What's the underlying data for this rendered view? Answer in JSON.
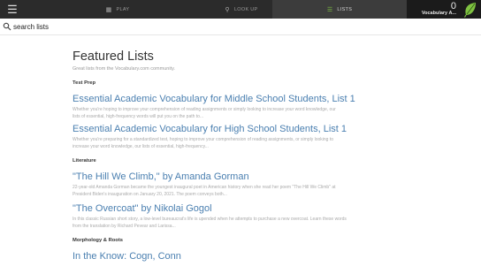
{
  "topbar": {
    "menu_icon": "hamburger-menu-icon",
    "nav": [
      {
        "label": "PLAY",
        "icon": "grid-icon"
      },
      {
        "label": "LOOK UP",
        "icon": "magnifier-icon"
      },
      {
        "label": "LISTS",
        "icon": "list-icon",
        "active": true
      }
    ],
    "user": {
      "score": "0",
      "name": "Vocabulary A..."
    },
    "accent_color": "#7fc241"
  },
  "search": {
    "placeholder": "search lists",
    "value": ""
  },
  "main": {
    "title": "Featured Lists",
    "subtitle": "Great lists from the Vocabulary.com community.",
    "sections": [
      {
        "title": "Test Prep",
        "lists": [
          {
            "title": "Essential Academic Vocabulary for Middle School Students, List 1",
            "desc1": "Whether you're hoping to improve your comprehension of reading assignments or simply looking to increase your word knowledge, our",
            "desc2": "lists of essential, high-frequency words will put you on the path to..."
          },
          {
            "title": "Essential Academic Vocabulary for High School Students, List 1",
            "desc1": "Whether you're preparing for a standardized test, hoping to improve your comprehension of reading assignments, or simply looking to",
            "desc2": "increase your word knowledge, our lists of essential, high-frequency..."
          }
        ]
      },
      {
        "title": "Literature",
        "lists": [
          {
            "title": "\"The Hill We Climb,\" by Amanda Gorman",
            "desc1": "22-year-old Amanda Gorman became the youngest inaugural poet in American history when she read her poem \"The Hill We Climb\" at",
            "desc2": "President Biden's inauguration on January 20, 2021. The poem conveys both..."
          },
          {
            "title": "\"The Overcoat\" by Nikolai Gogol",
            "desc1": "In this classic Russian short story, a low-level bureaucrat's life is upended when he attempts to purchase a new overcoat. Learn these words",
            "desc2": "from the translation by Richard Pevear and Larissa..."
          }
        ]
      },
      {
        "title": "Morphology & Roots",
        "lists": [
          {
            "title": "In the Know: Cogn, Conn",
            "desc1": "",
            "desc2": ""
          }
        ]
      }
    ]
  }
}
